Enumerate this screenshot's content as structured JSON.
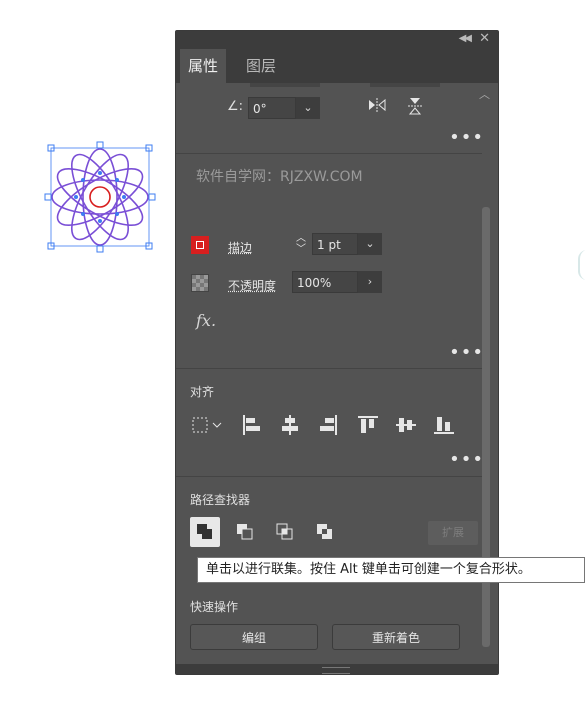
{
  "panel": {
    "tabs": [
      {
        "label": "属性"
      },
      {
        "label": "图层"
      }
    ],
    "collapse_icon": "double-chevron-left-icon",
    "close_icon": "close-icon",
    "more_label": "•••"
  },
  "transform": {
    "angle_value": "0°",
    "angle_icon": "angle-icon",
    "flip_horizontal_icon": "flip-horizontal-icon",
    "flip_vertical_icon": "flip-vertical-icon"
  },
  "watermark": "软件自学网：RJZXW.COM",
  "appearance": {
    "stroke_label": "描边",
    "stroke_value": "1 pt",
    "stroke_color": "#d81f1f",
    "opacity_label": "不透明度",
    "opacity_value": "100%",
    "fx_label": "fx."
  },
  "align": {
    "title": "对齐",
    "icons": [
      "align-to-selection-icon",
      "align-left-icon",
      "align-horizontal-center-icon",
      "align-right-icon",
      "align-top-icon",
      "align-vertical-center-icon",
      "align-bottom-icon"
    ]
  },
  "pathfinder": {
    "title": "路径查找器",
    "icons": [
      "unite-icon",
      "minus-front-icon",
      "intersect-icon",
      "exclude-icon"
    ],
    "expand_label": "扩展"
  },
  "tooltip": "单击以进行联集。按住 Alt 键单击可创建一个复合形状。",
  "quick_actions": {
    "title": "快速操作",
    "group_label": "编组",
    "recolor_label": "重新着色"
  },
  "colors": {
    "panel_bg": "#535353",
    "header_bg": "#3c3c3c",
    "artwork_stroke": "#7a4fd6",
    "selection_color": "#3d7cf2",
    "accent_red": "#d81f1f"
  }
}
